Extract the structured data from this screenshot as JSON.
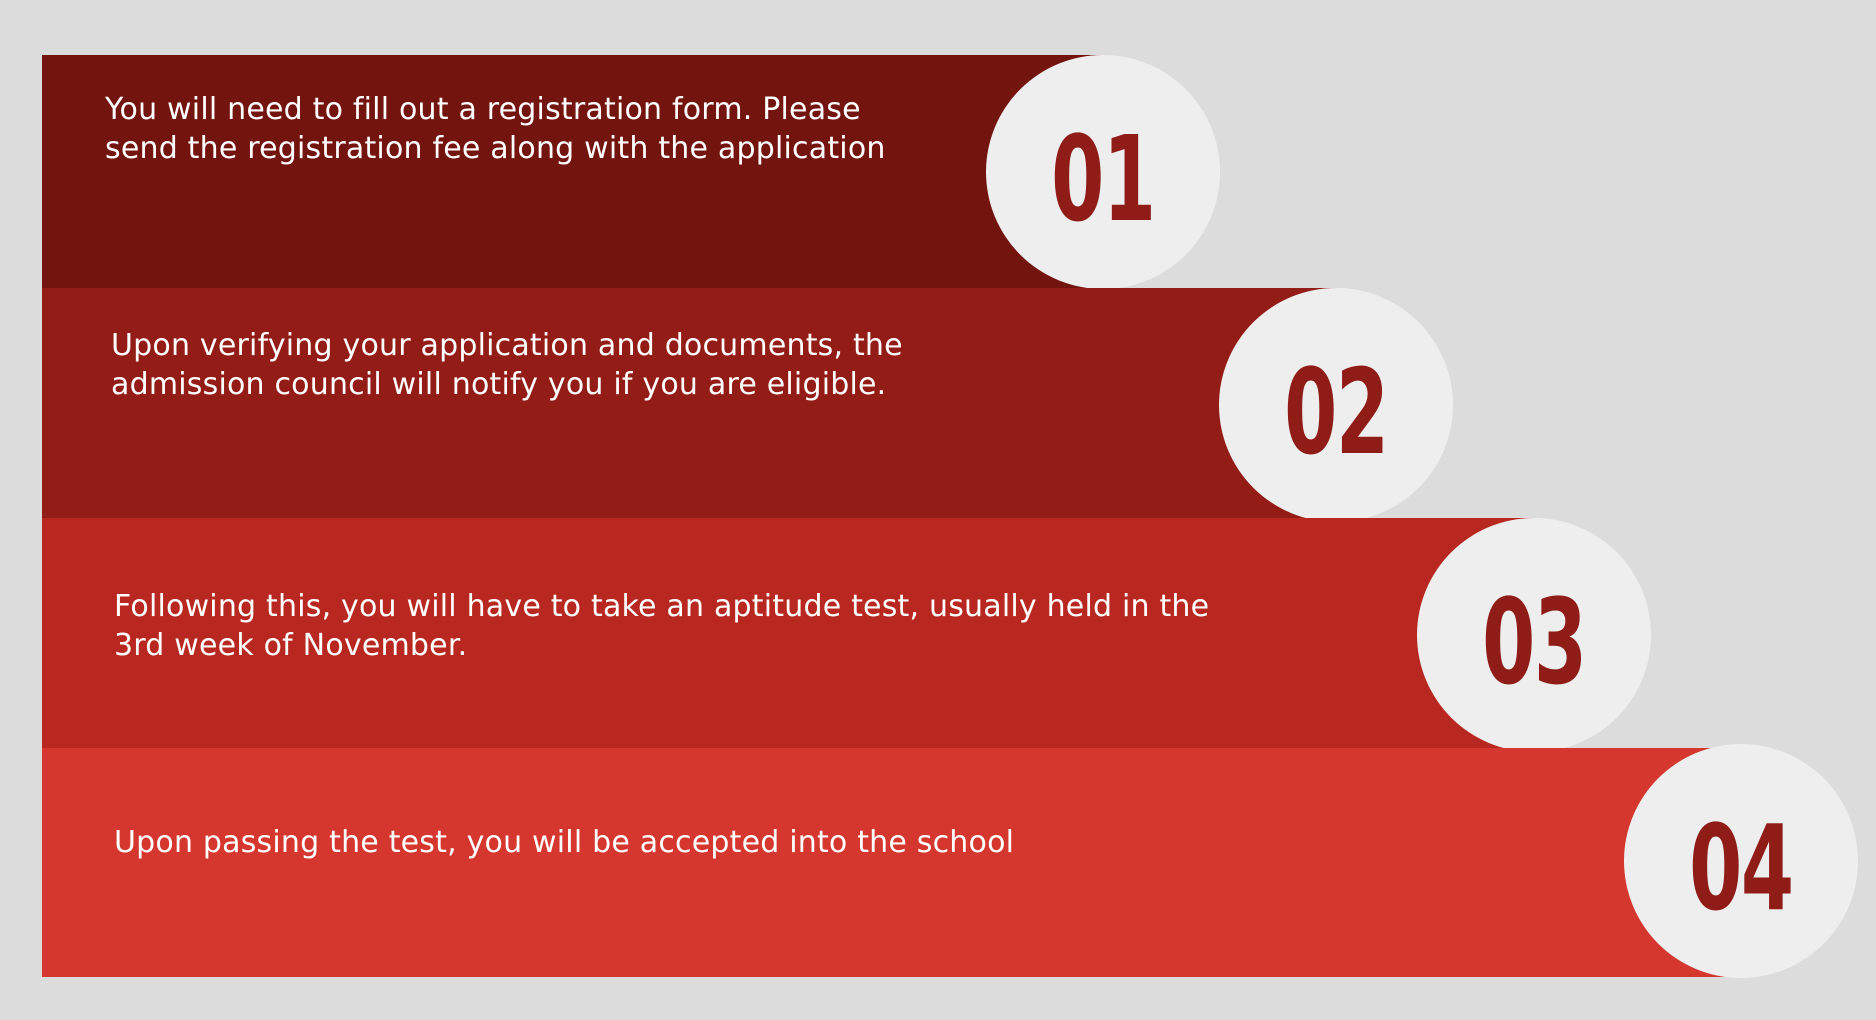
{
  "steps": [
    {
      "number": "01",
      "text": "You will need to fill out a registration form. Please send the registration fee along with the application",
      "color": "#73140f"
    },
    {
      "number": "02",
      "text": "Upon verifying your application and documents, the admission council will notify you if you are eligible.",
      "color": "#941c16"
    },
    {
      "number": "03",
      "text": "Following this, you will have to take an aptitude test, usually held in the 3rd week of November.",
      "color": "#b92820"
    },
    {
      "number": "04",
      "text": "Upon passing the test, you will be accepted into the school",
      "color": "#d5372e"
    }
  ],
  "number_color": "#8f1c17",
  "circle_color": "#efeeee",
  "background_color": "#dcdcdc"
}
